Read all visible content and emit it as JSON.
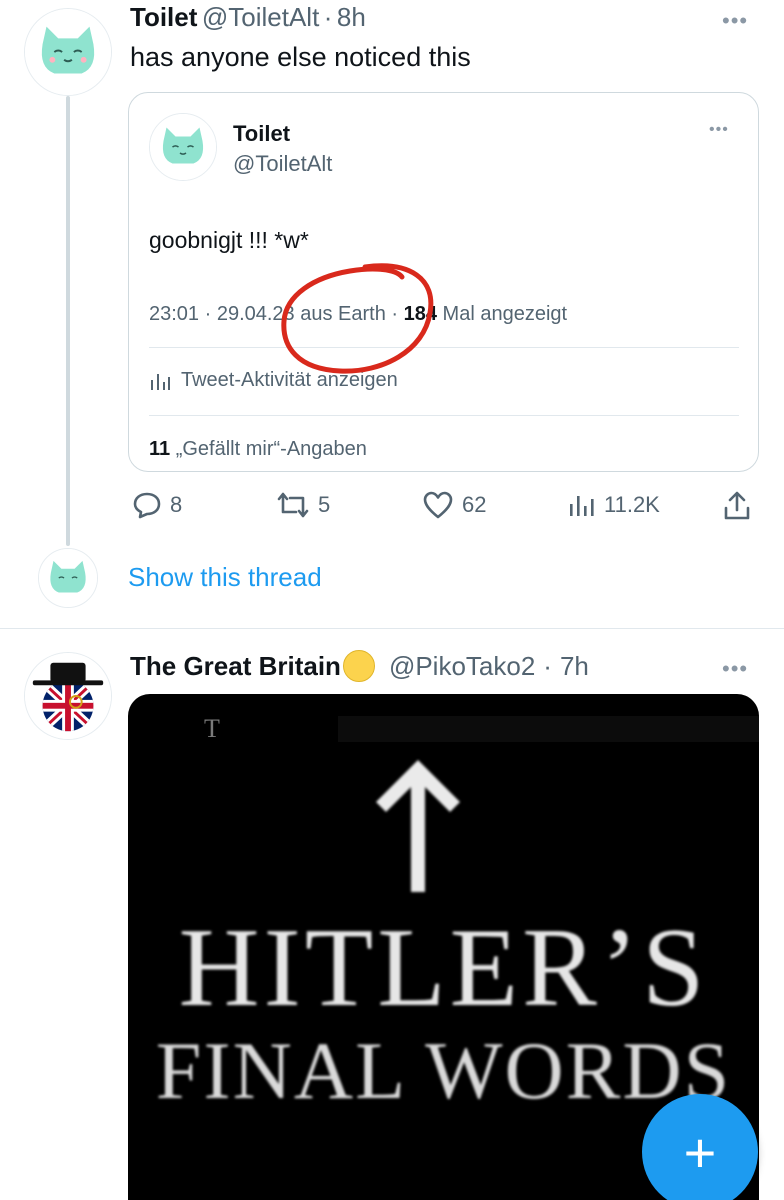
{
  "tweet1": {
    "name": "Toilet",
    "handle": "@ToiletAlt",
    "dot": "·",
    "time": "8h",
    "text": "has anyone else noticed this",
    "more": "•••"
  },
  "quote": {
    "name": "Toilet",
    "handle": "@ToiletAlt",
    "text": "goobnigjt !!! *w*",
    "meta_prefix": "23:01 · 29.04.23 aus Earth · ",
    "views_count": "184",
    "views_suffix": " Mal angezeigt",
    "activity_label": "Tweet-Aktivität anzeigen",
    "likes_count": "11",
    "likes_label": " „Gefällt mir“-Angaben",
    "more": "•••"
  },
  "actions": {
    "reply_count": "8",
    "retweet_count": "5",
    "like_count": "62",
    "views_count": "11.2K"
  },
  "show_thread": "Show this thread",
  "tweet2": {
    "name": "The Great Britain",
    "emoji": "🟡",
    "handle": "@PikoTako2",
    "dot": "·",
    "time": "7h",
    "more": "•••",
    "media_corner": "T",
    "media_line1": "HITLER’S",
    "media_line2": "FINAL WORDS"
  },
  "fab_label": "+",
  "colors": {
    "accent": "#1d9bf0",
    "annotation_red": "#d9291c",
    "cat_teal": "#8fe3cf"
  }
}
